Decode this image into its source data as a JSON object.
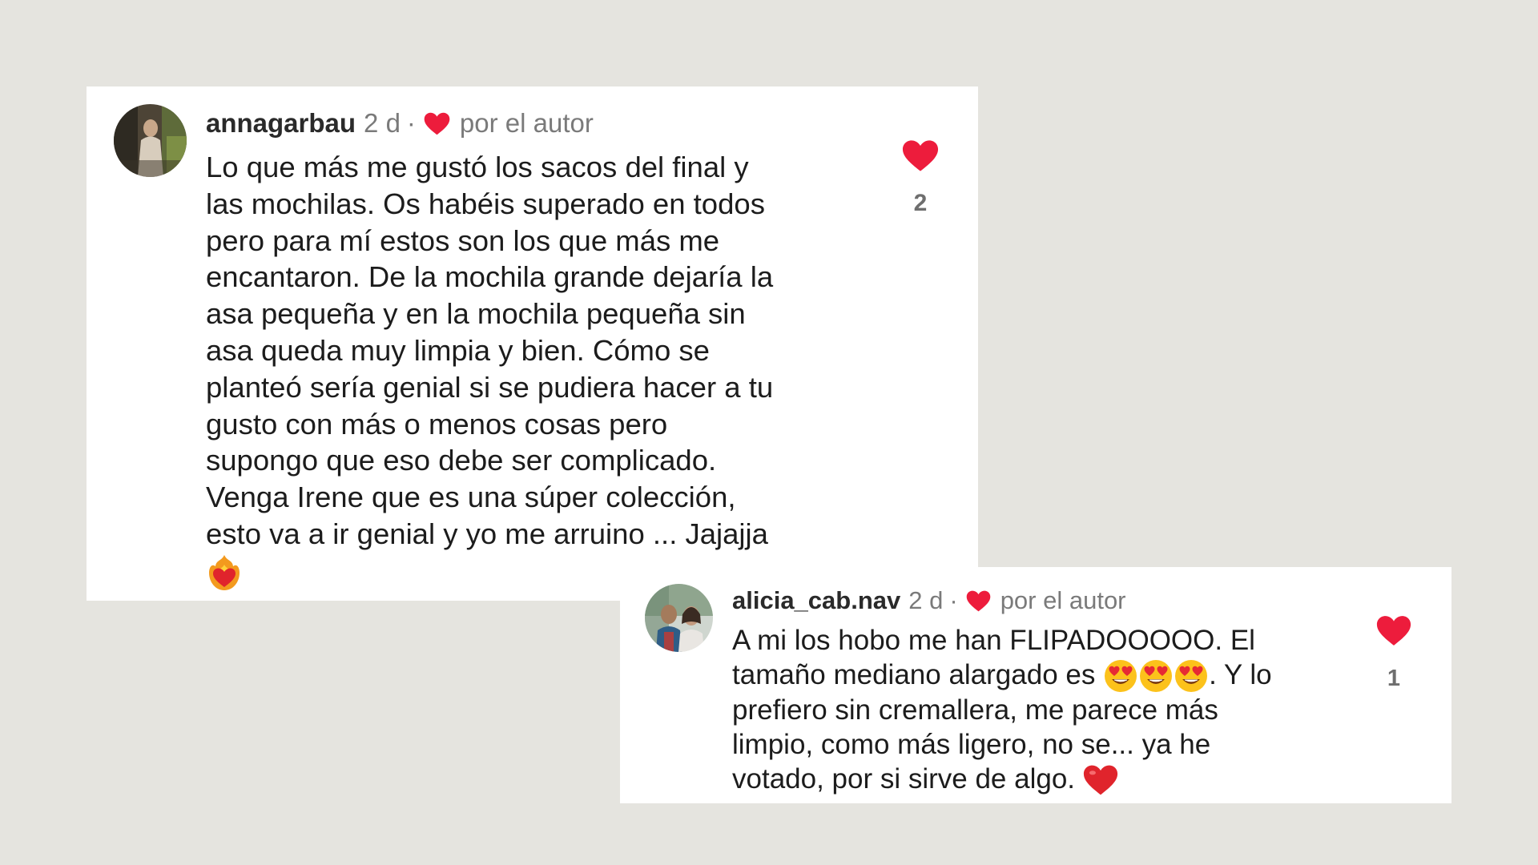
{
  "comments": [
    {
      "username": "annagarbau",
      "time": "2 d",
      "separator": "·",
      "liked_by_author_label": "por el autor",
      "text_lines": [
        "Lo que más me gustó los sacos del final y",
        "las mochilas. Os habéis superado en todos",
        "pero para mí estos son los que más me",
        "encantaron. De la mochila grande dejaría la",
        "asa pequeña y en la mochila pequeña sin",
        "asa queda muy limpia y bien. Cómo se",
        "planteó sería genial si se pudiera hacer a tu",
        "gusto con más o menos cosas pero",
        "supongo que eso debe ser complicado.",
        "Venga Irene que es una súper colección,",
        "esto va a ir genial y yo me arruino ... Jajajja"
      ],
      "trailing_emoji": "heart-on-fire-emoji",
      "like_count": "2",
      "like_icon": "heart-icon",
      "heart_color": "#ed1c3c"
    },
    {
      "username": "alicia_cab.nav",
      "time": "2 d",
      "separator": "·",
      "liked_by_author_label": "por el autor",
      "text_line_1": "A mi los hobo me han FLIPADOOOOO.  El",
      "text_line_2_before": "tamaño mediano alargado es",
      "text_line_2_emojis": [
        "heart-eyes-emoji",
        "heart-eyes-emoji",
        "heart-eyes-emoji"
      ],
      "text_line_2_after": ". Y lo",
      "text_line_3": "prefiero sin cremallera, me parece más",
      "text_line_4": "limpio, como más ligero,  no se... ya he",
      "text_line_5": "votado, por si sirve de algo.",
      "trailing_emoji": "red-heart-emoji",
      "like_count": "1",
      "like_icon": "heart-icon",
      "heart_color": "#ed1c3c"
    }
  ],
  "colors": {
    "background": "#e5e4df",
    "card": "#ffffff",
    "heart": "#ed1c3c",
    "meta_text": "#7a7a7a"
  }
}
